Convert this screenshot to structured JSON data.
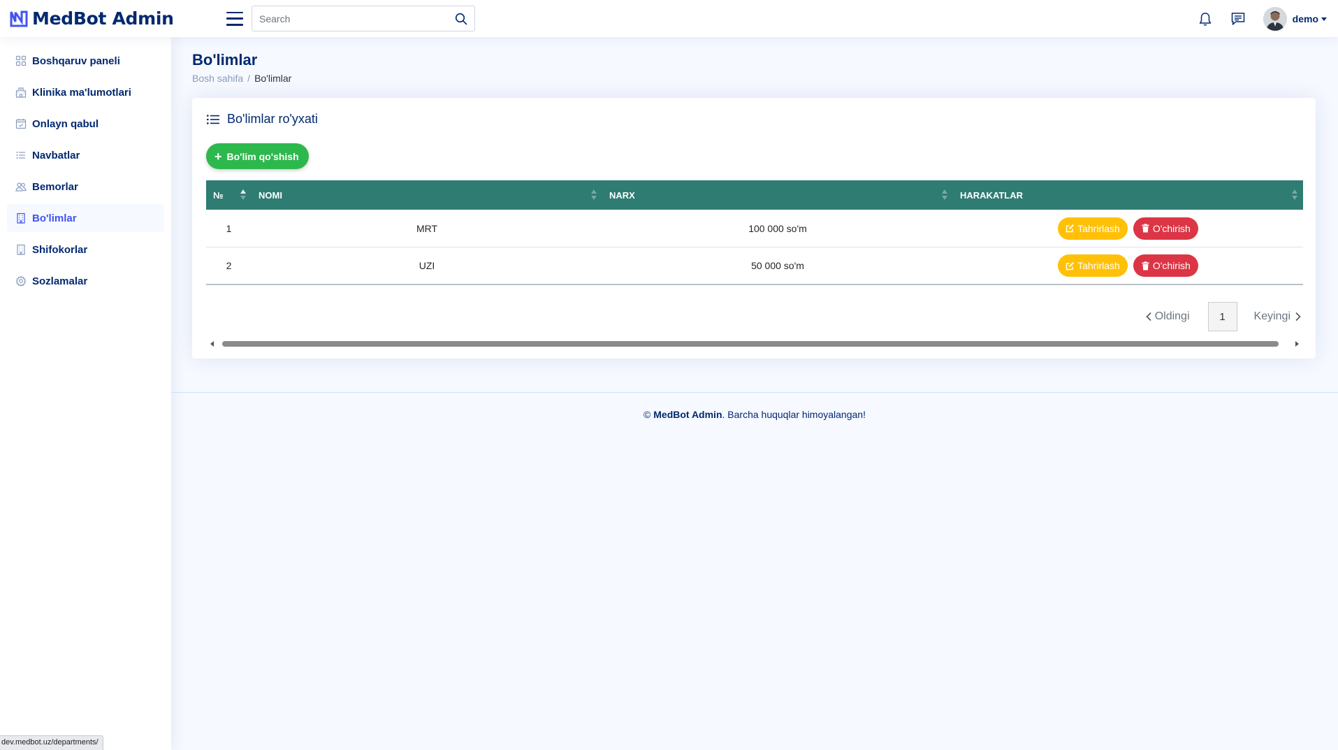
{
  "header": {
    "brand": "MedBot Admin",
    "search_placeholder": "Search",
    "user_name": "demo"
  },
  "sidebar": {
    "items": [
      {
        "label": "Boshqaruv paneli",
        "icon": "grid-icon",
        "active": false
      },
      {
        "label": "Klinika ma'lumotlari",
        "icon": "hospital-icon",
        "active": false
      },
      {
        "label": "Onlayn qabul",
        "icon": "calendar-check-icon",
        "active": false
      },
      {
        "label": "Navbatlar",
        "icon": "list-icon",
        "active": false
      },
      {
        "label": "Bemorlar",
        "icon": "people-icon",
        "active": false
      },
      {
        "label": "Bo'limlar",
        "icon": "building-icon",
        "active": true
      },
      {
        "label": "Shifokorlar",
        "icon": "building-icon",
        "active": false
      },
      {
        "label": "Sozlamalar",
        "icon": "gear-icon",
        "active": false
      }
    ]
  },
  "page": {
    "title": "Bo'limlar",
    "breadcrumb_home": "Bosh sahifa",
    "breadcrumb_sep": "/",
    "breadcrumb_current": "Bo'limlar"
  },
  "card": {
    "title": "Bo'limlar ro'yxati",
    "add_button": "Bo'lim qo'shish"
  },
  "table": {
    "headers": [
      "№",
      "NOMI",
      "NARX",
      "HARAKATLAR"
    ],
    "rows": [
      {
        "num": "1",
        "name": "MRT",
        "price": "100 000 so'm"
      },
      {
        "num": "2",
        "name": "UZI",
        "price": "50 000 so'm"
      }
    ],
    "edit_label": "Tahrirlash",
    "delete_label": "O'chirish"
  },
  "pagination": {
    "prev": "Oldingi",
    "page": "1",
    "next": "Keyingi"
  },
  "footer": {
    "copyright": "©",
    "brand": "MedBot Admin",
    "text": ". Barcha huquqlar himoyalangan!"
  },
  "status_bar": {
    "url": "dev.medbot.uz/departments/"
  },
  "colors": {
    "brand": "#012970",
    "accent": "#4154f1",
    "table_header": "#2f7c73",
    "add_button": "#2db84d",
    "edit_button": "#ffc107",
    "delete_button": "#dc3545"
  }
}
